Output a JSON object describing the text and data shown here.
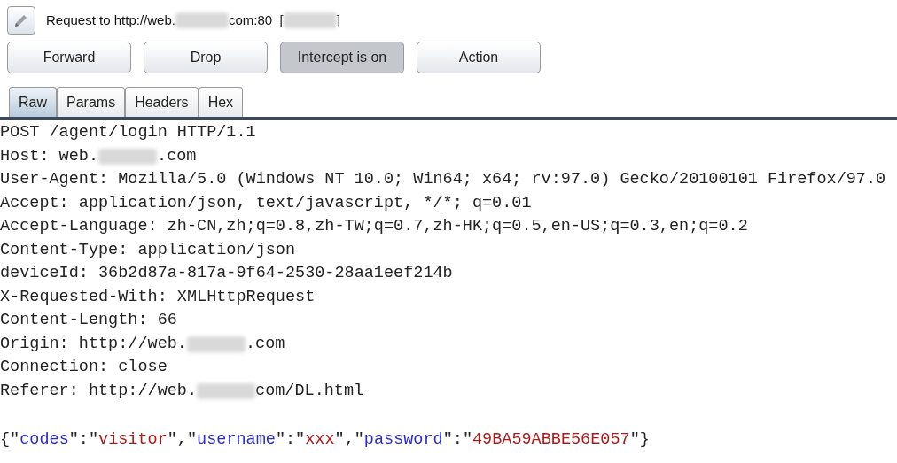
{
  "title": {
    "parts": [
      {
        "kind": "text",
        "text": "Request to http://web."
      },
      {
        "kind": "redacted"
      },
      {
        "kind": "text",
        "text": "com:80  ["
      },
      {
        "kind": "redacted"
      },
      {
        "kind": "text",
        "text": "]"
      }
    ]
  },
  "buttons": [
    {
      "label": "Forward",
      "pressed": false
    },
    {
      "label": "Drop",
      "pressed": false
    },
    {
      "label": "Intercept is on",
      "pressed": true
    },
    {
      "label": "Action",
      "pressed": false
    }
  ],
  "tabs": [
    {
      "label": "Raw",
      "selected": true
    },
    {
      "label": "Params",
      "selected": false
    },
    {
      "label": "Headers",
      "selected": false
    },
    {
      "label": "Hex",
      "selected": false
    }
  ],
  "request_lines": [
    {
      "parts": [
        {
          "kind": "text",
          "text": "POST /agent/login HTTP/1.1"
        }
      ]
    },
    {
      "parts": [
        {
          "kind": "text",
          "text": "Host: web."
        },
        {
          "kind": "redacted"
        },
        {
          "kind": "text",
          "text": ".com"
        }
      ]
    },
    {
      "parts": [
        {
          "kind": "text",
          "text": "User-Agent: Mozilla/5.0 (Windows NT 10.0; Win64; x64; rv:97.0) Gecko/20100101 Firefox/97.0"
        }
      ]
    },
    {
      "parts": [
        {
          "kind": "text",
          "text": "Accept: application/json, text/javascript, */*; q=0.01"
        }
      ]
    },
    {
      "parts": [
        {
          "kind": "text",
          "text": "Accept-Language: zh-CN,zh;q=0.8,zh-TW;q=0.7,zh-HK;q=0.5,en-US;q=0.3,en;q=0.2"
        }
      ]
    },
    {
      "parts": [
        {
          "kind": "text",
          "text": "Content-Type: application/json"
        }
      ]
    },
    {
      "parts": [
        {
          "kind": "text",
          "text": "deviceId: 36b2d87a-817a-9f64-2530-28aa1eef214b"
        }
      ]
    },
    {
      "parts": [
        {
          "kind": "text",
          "text": "X-Requested-With: XMLHttpRequest"
        }
      ]
    },
    {
      "parts": [
        {
          "kind": "text",
          "text": "Content-Length: 66"
        }
      ]
    },
    {
      "parts": [
        {
          "kind": "text",
          "text": "Origin: http://web."
        },
        {
          "kind": "redacted"
        },
        {
          "kind": "text",
          "text": ".com"
        }
      ]
    },
    {
      "parts": [
        {
          "kind": "text",
          "text": "Connection: close"
        }
      ]
    },
    {
      "parts": [
        {
          "kind": "text",
          "text": "Referer: http://web."
        },
        {
          "kind": "redacted"
        },
        {
          "kind": "text",
          "text": "com/DL.html"
        }
      ]
    }
  ],
  "body": [
    {
      "kind": "punct",
      "text": "{\""
    },
    {
      "kind": "key",
      "text": "codes"
    },
    {
      "kind": "punct",
      "text": "\":\""
    },
    {
      "kind": "value",
      "text": "visitor"
    },
    {
      "kind": "punct",
      "text": "\",\""
    },
    {
      "kind": "key",
      "text": "username"
    },
    {
      "kind": "punct",
      "text": "\":\""
    },
    {
      "kind": "value",
      "text": "xxx"
    },
    {
      "kind": "punct",
      "text": "\",\""
    },
    {
      "kind": "key",
      "text": "password"
    },
    {
      "kind": "punct",
      "text": "\":\""
    },
    {
      "kind": "value",
      "text": "49BA59ABBE56E057"
    },
    {
      "kind": "punct",
      "text": "\"}"
    }
  ]
}
